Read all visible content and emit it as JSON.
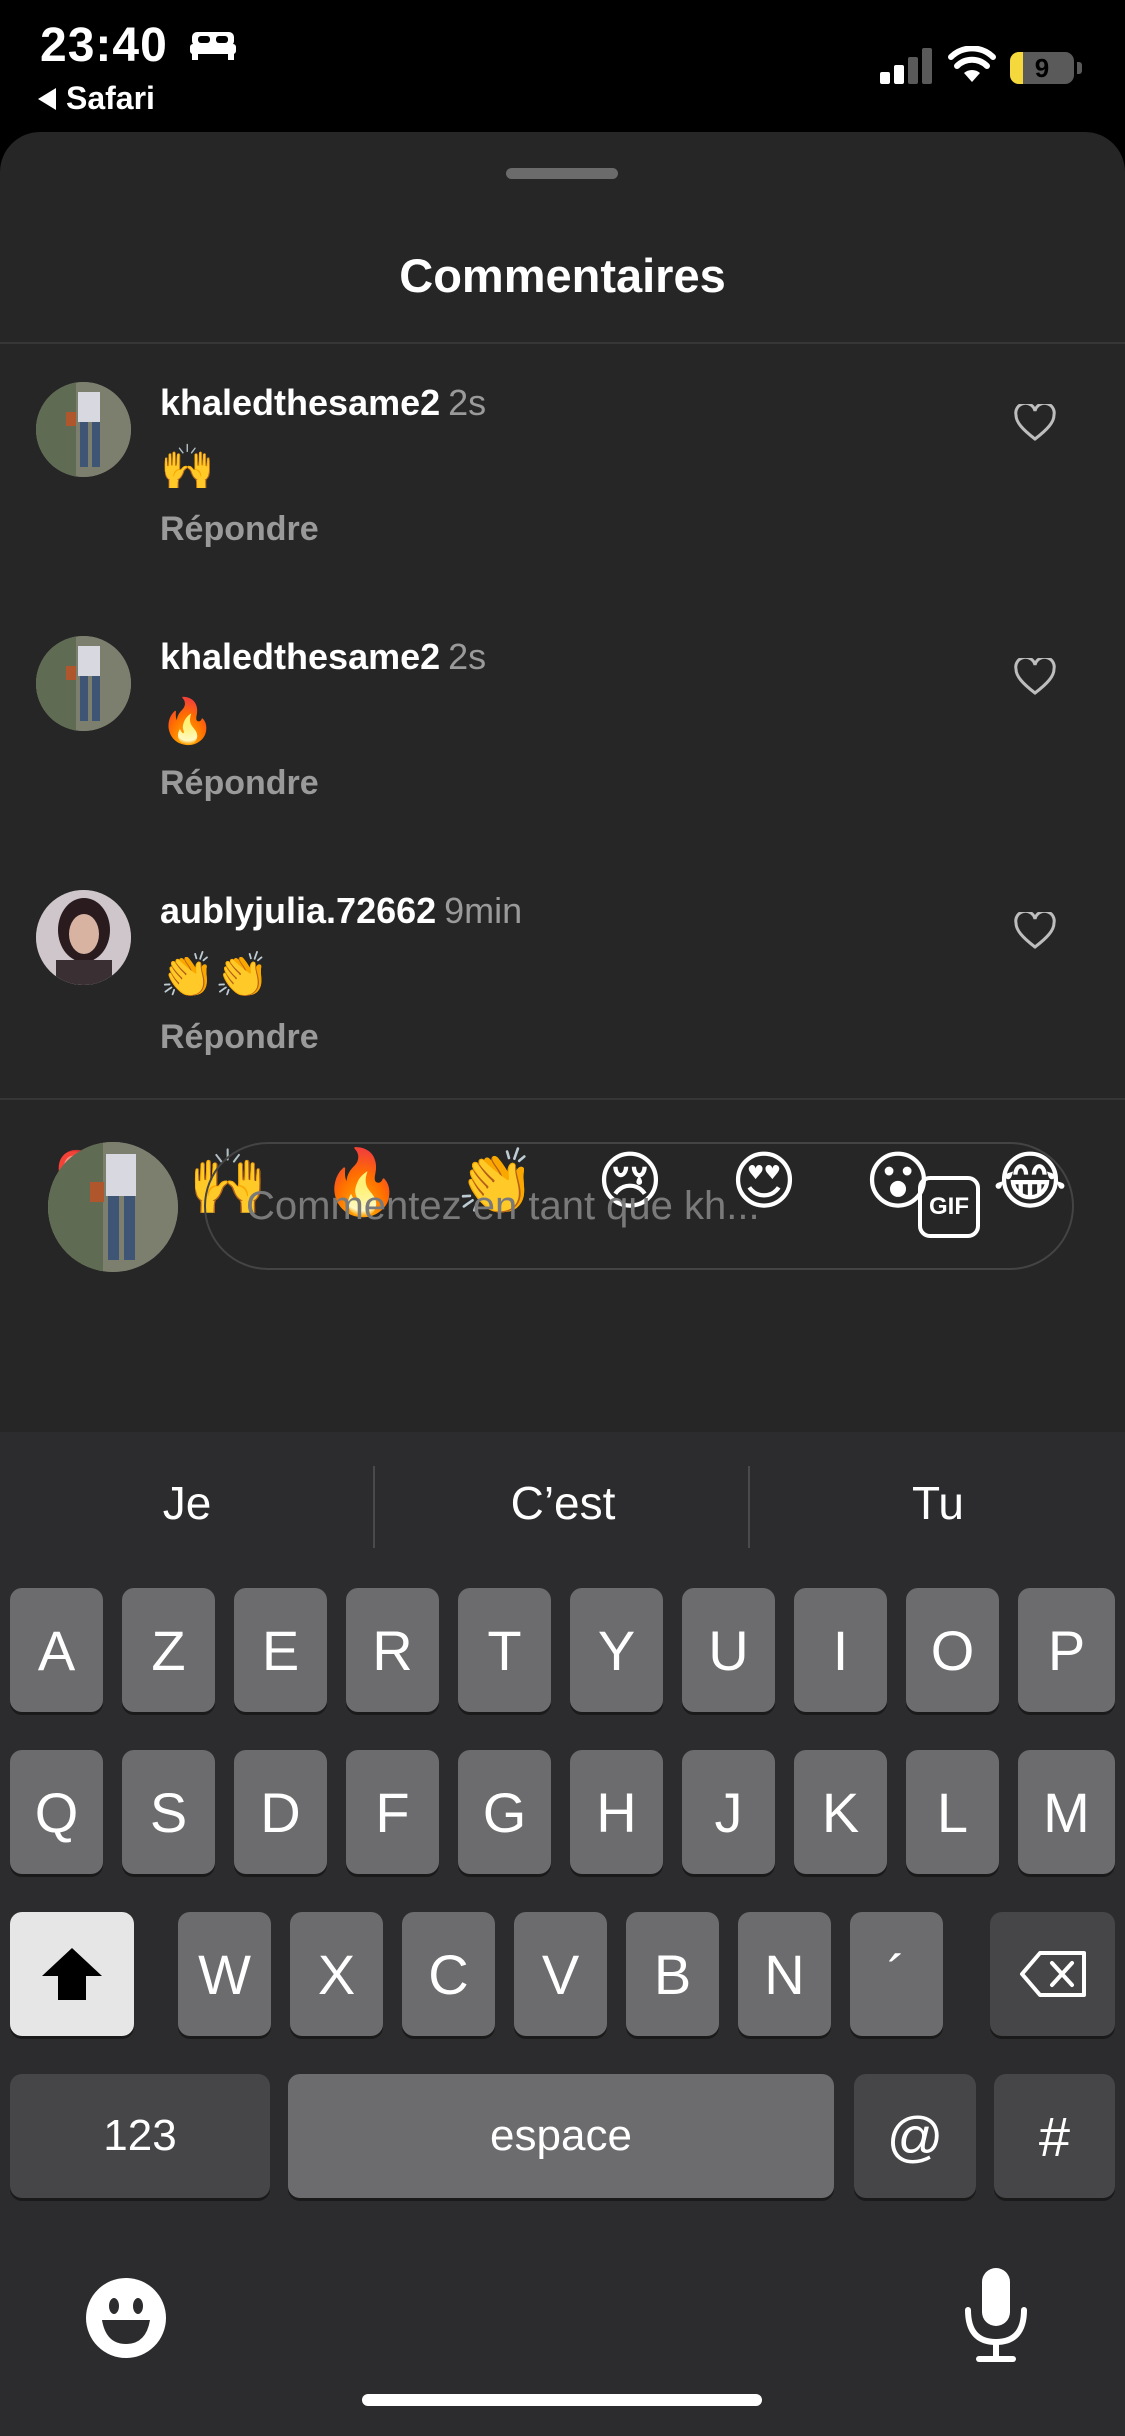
{
  "status_bar": {
    "time": "23:40",
    "back_app": "Safari",
    "battery_level": "9",
    "battery_percent": 9
  },
  "sheet": {
    "title": "Commentaires"
  },
  "comments": [
    {
      "username": "khaledthesame2",
      "time": "2s",
      "text": "🙌",
      "reply_label": "Répondre"
    },
    {
      "username": "khaledthesame2",
      "time": "2s",
      "text": "🔥",
      "reply_label": "Répondre"
    },
    {
      "username": "aublyjulia.72662",
      "time": "9min",
      "text": "👏👏",
      "reply_label": "Répondre"
    }
  ],
  "quick_reactions": [
    "❤️",
    "🙌",
    "🔥",
    "👏",
    "😢",
    "😍",
    "😮",
    "😂"
  ],
  "composer": {
    "placeholder": "Commentez en tant que kh...",
    "gif_label": "GIF"
  },
  "keyboard": {
    "predictions": [
      "Je",
      "C’est",
      "Tu"
    ],
    "row1": [
      "A",
      "Z",
      "E",
      "R",
      "T",
      "Y",
      "U",
      "I",
      "O",
      "P"
    ],
    "row2": [
      "Q",
      "S",
      "D",
      "F",
      "G",
      "H",
      "J",
      "K",
      "L",
      "M"
    ],
    "row3": [
      "W",
      "X",
      "C",
      "V",
      "B",
      "N",
      "´"
    ],
    "numbers_label": "123",
    "space_label": "espace",
    "at_label": "@",
    "hash_label": "#"
  },
  "colors": {
    "sheet_bg": "#262626",
    "keyboard_bg": "#2c2c2e",
    "key": "#6c6c6e",
    "muted_text": "#9a9a9a",
    "battery": "#f5d83c"
  }
}
